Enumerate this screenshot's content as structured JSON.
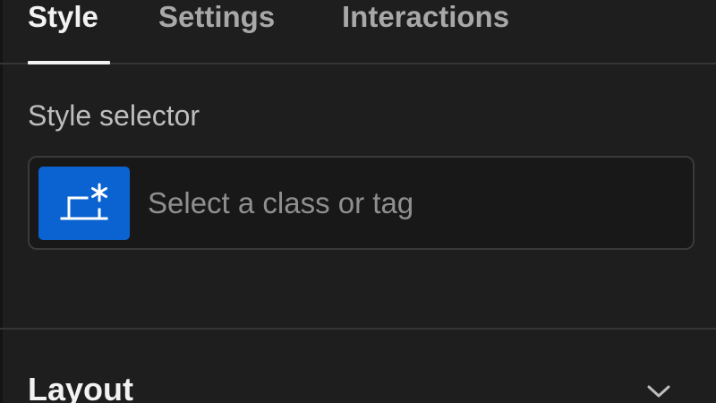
{
  "tabs": [
    {
      "label": "Style",
      "active": true
    },
    {
      "label": "Settings",
      "active": false
    },
    {
      "label": "Interactions",
      "active": false
    }
  ],
  "style_selector": {
    "label": "Style selector",
    "placeholder": "Select a class or tag",
    "value": "",
    "icon": "class-selector-icon"
  },
  "layout_section": {
    "title": "Layout",
    "icon": "chevron-down-icon"
  },
  "colors": {
    "background": "#1e1e1e",
    "accent": "#0b63d1",
    "active_tab": "#f2f2f2",
    "inactive_tab": "#a8a8a8"
  }
}
